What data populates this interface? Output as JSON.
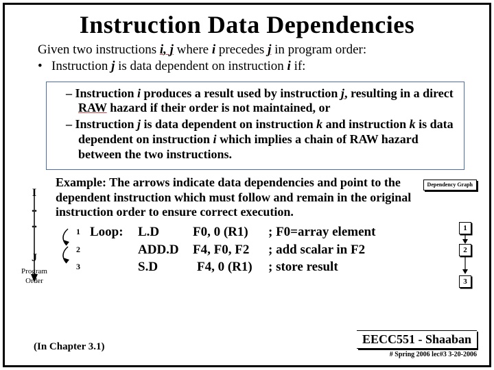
{
  "title": "Instruction Data Dependencies",
  "intro_line1a": "Given two instructions  ",
  "intro_line1b": " where  ",
  "intro_line1c": " precedes ",
  "intro_line1d": " in program order:",
  "bullet_dot": "•",
  "bullet_a": "Instruction  ",
  "bullet_b": "  is data dependent on instruction  ",
  "bullet_c": "  if:",
  "i": "i",
  "j": "j",
  "ij": "i, j",
  "k": "k",
  "box1a": "–  Instruction   ",
  "box1b": "  produces a result used by instruction ",
  "box1c": ",  resulting in a direct ",
  "raw": "RAW",
  "box1d": " hazard if their order is not maintained, or",
  "box2a": "–  Instruction  ",
  "box2b": "  is data dependent on instruction  ",
  "box2c": "  and instruction  ",
  "box2d": "  is data dependent on instruction  ",
  "box2e": "  which implies  a chain of ",
  "box2f": " hazard between the two instructions.",
  "left": {
    "I": "I",
    "dots": "..",
    "J": "J",
    "prog1": "Program",
    "prog2": "Order"
  },
  "example": "Example:  The arrows indicate data dependencies and point to the dependent instruction which must follow and remain in the original instruction order to ensure correct execution.",
  "dep_badge": "Dependency\nGraph",
  "code": {
    "loop": "Loop:",
    "rows": [
      {
        "n": "1",
        "instr": "L.D",
        "ops": "F0, 0 (R1)",
        "cmt": "; F0=array element"
      },
      {
        "n": "2",
        "instr": "ADD.D",
        "ops": "F4, F0, F2",
        "cmt": "; add scalar in F2"
      },
      {
        "n": "3",
        "instr": "S.D",
        "ops": "F4, 0 (R1)",
        "cmt": "; store result"
      }
    ]
  },
  "circles": [
    "1",
    "2",
    "3"
  ],
  "chapter": "(In  Chapter 3.1)",
  "course": "EECC551 - Shaaban",
  "slide_info": "#  Spring 2006 lec#3   3-20-2006"
}
